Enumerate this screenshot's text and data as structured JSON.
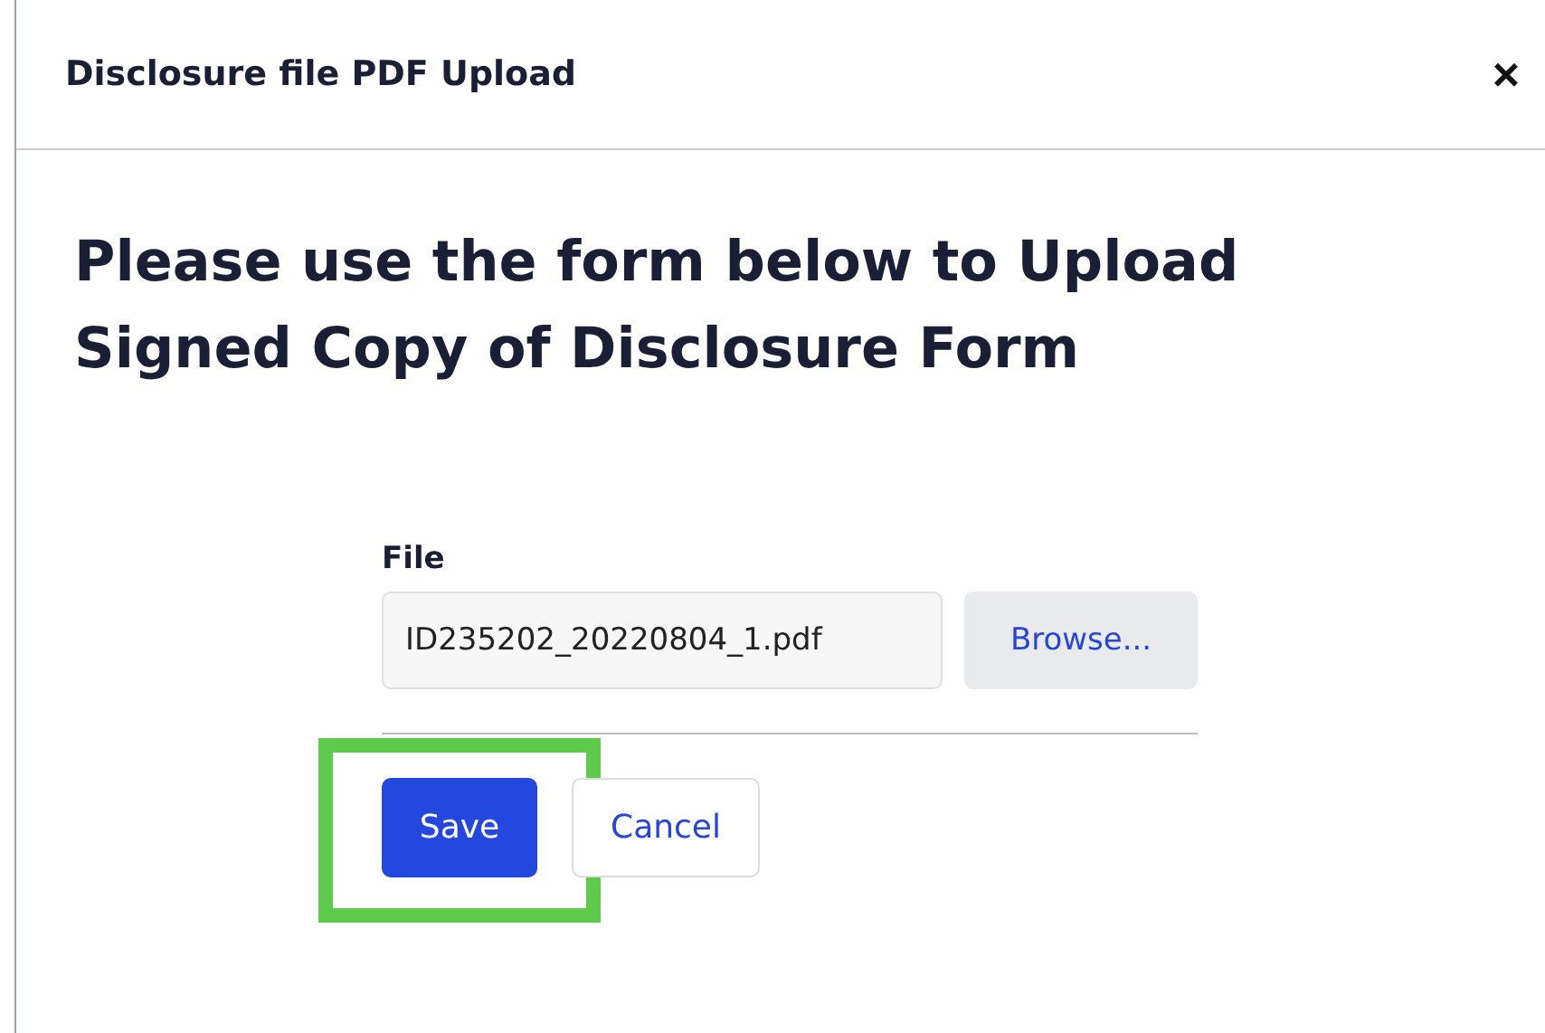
{
  "modal": {
    "title": "Disclosure file PDF Upload",
    "close": "×"
  },
  "heading": "Please use the form below to Upload Signed Copy of Disclosure Form",
  "file_field": {
    "label": "File",
    "value": "ID235202_20220804_1.pdf",
    "browse": "Browse..."
  },
  "save_highlight_frame": true,
  "buttons": [
    {
      "kind": "primary",
      "label": "Save"
    },
    {
      "kind": "secondary",
      "label": "Cancel"
    }
  ]
}
